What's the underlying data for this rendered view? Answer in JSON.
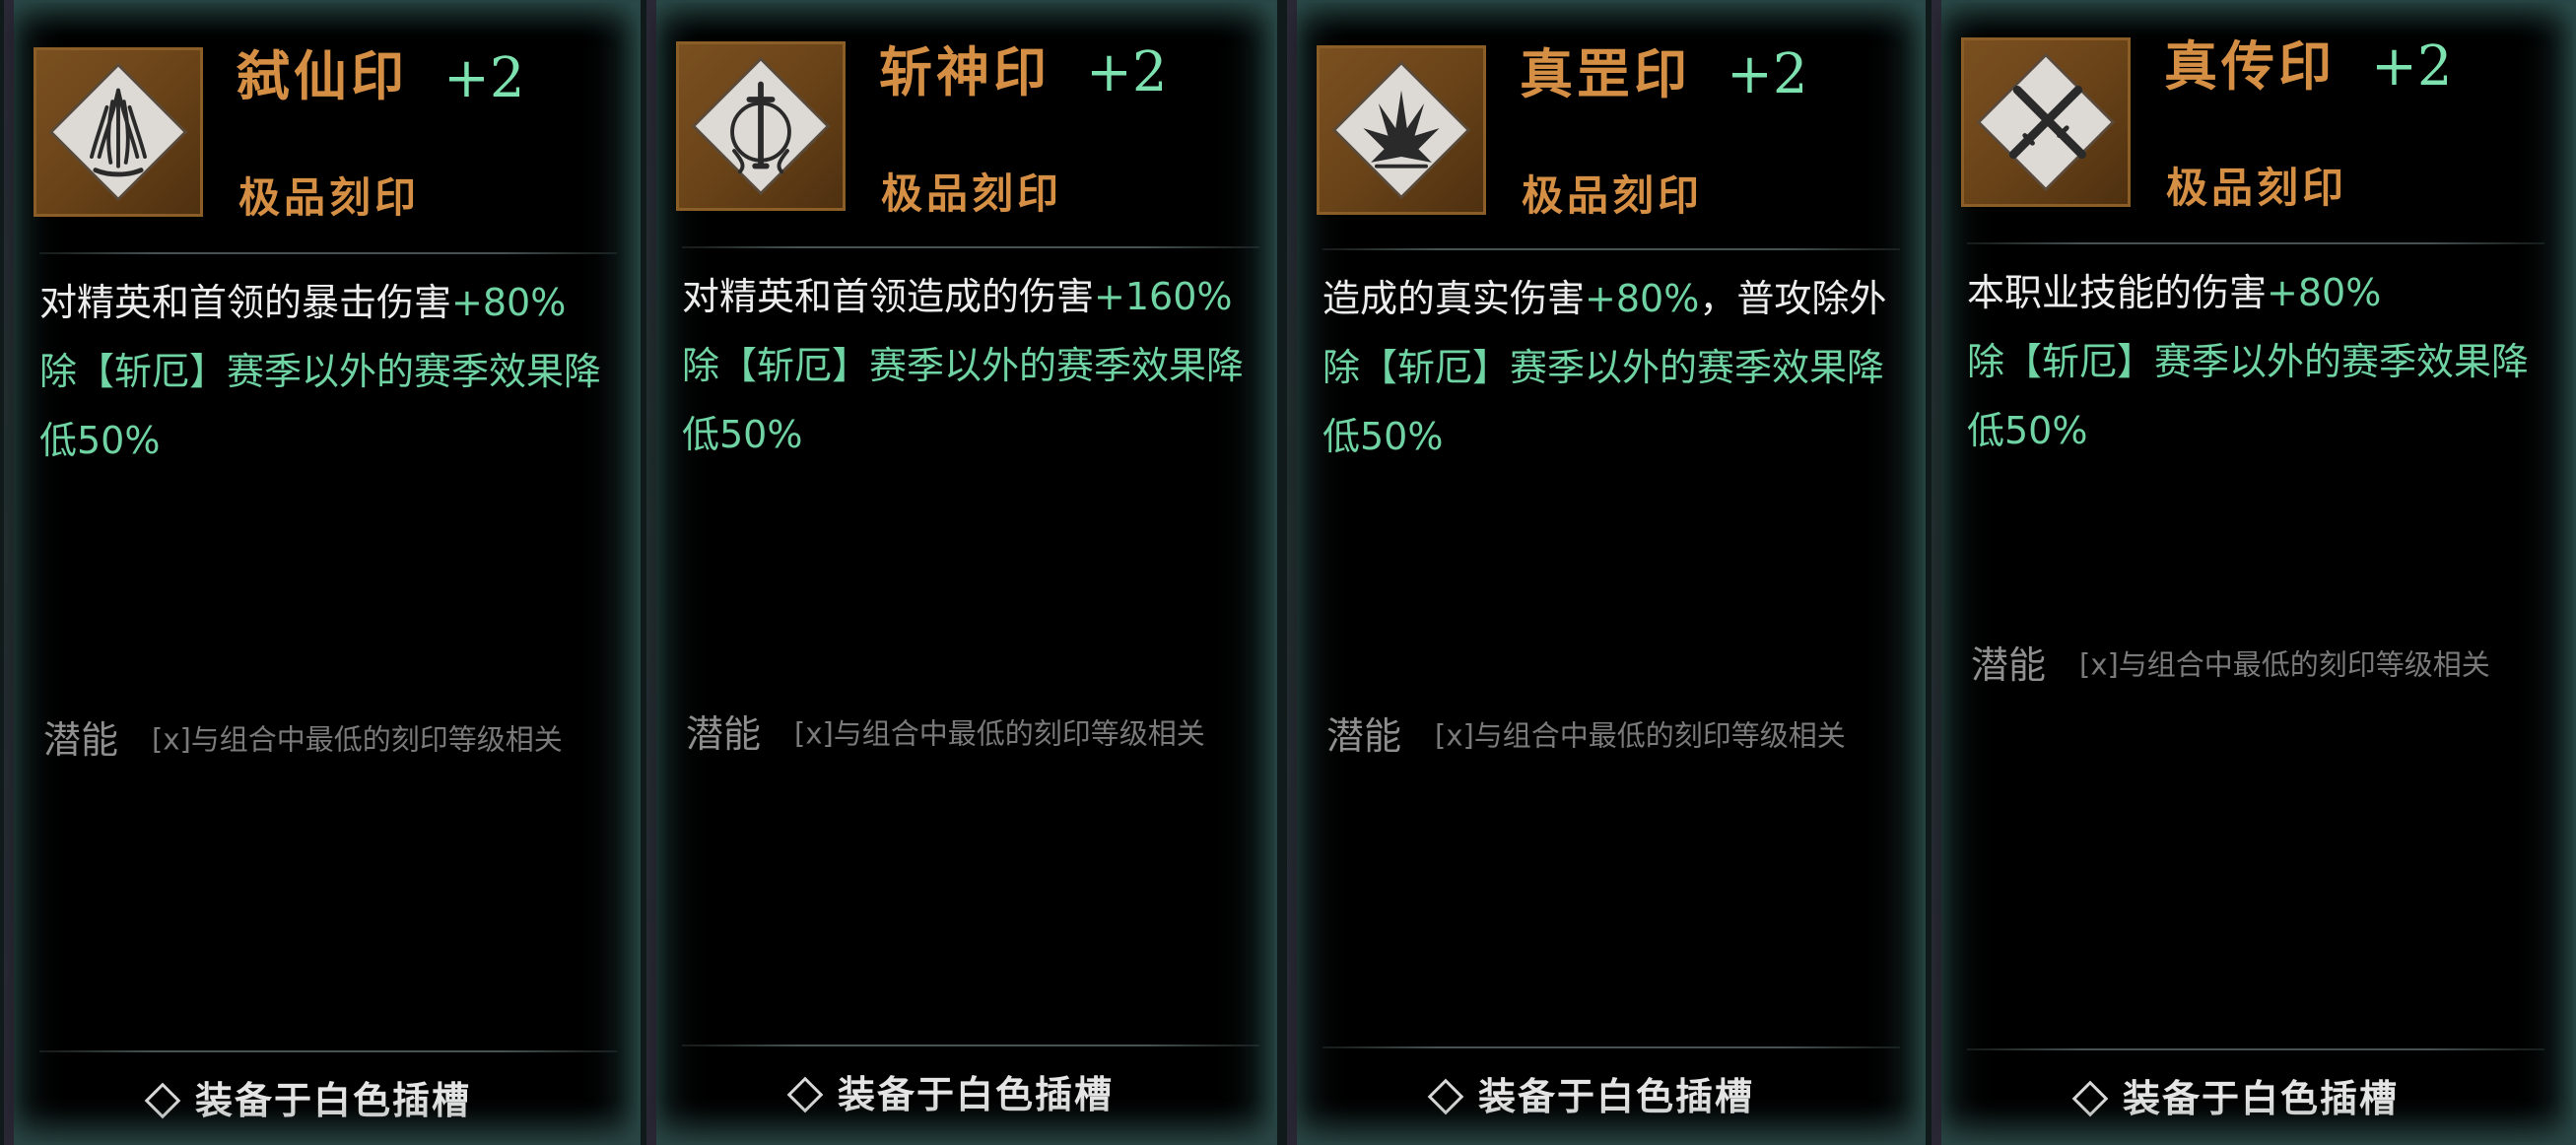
{
  "cards": [
    {
      "title": "弑仙印",
      "level": "+2",
      "grade": "极品刻印",
      "icon": "leaf-flame-seal-icon",
      "desc": [
        {
          "text": "对精英和首领的暴击伤害",
          "color": "white"
        },
        {
          "text": "+80%",
          "color": "green"
        },
        {
          "text": "除【斩厄】赛季以外的赛季效果降低50%",
          "color": "green"
        }
      ],
      "potential_label": "潜能",
      "potential_note": "[x]与组合中最低的刻印等级相关",
      "footer": "装备于白色插槽"
    },
    {
      "title": "斩神印",
      "level": "+2",
      "grade": "极品刻印",
      "icon": "sword-ring-seal-icon",
      "desc": [
        {
          "text": "对精英和首领造成的伤害",
          "color": "white"
        },
        {
          "text": "+160%",
          "color": "green"
        },
        {
          "text": "除【斩厄】赛季以外的赛季效果降低50%",
          "color": "green"
        }
      ],
      "potential_label": "潜能",
      "potential_note": "[x]与组合中最低的刻印等级相关",
      "footer": "装备于白色插槽"
    },
    {
      "title": "真罡印",
      "level": "+2",
      "grade": "极品刻印",
      "icon": "spike-burst-seal-icon",
      "desc": [
        {
          "text": "造成的真实伤害",
          "color": "white"
        },
        {
          "text": "+80%",
          "color": "green"
        },
        {
          "text": "，普攻除外",
          "color": "white"
        },
        {
          "text": "除【斩厄】赛季以外的赛季效果降低50%",
          "color": "green"
        }
      ],
      "potential_label": "潜能",
      "potential_note": "[x]与组合中最低的刻印等级相关",
      "footer": "装备于白色插槽"
    },
    {
      "title": "真传印",
      "level": "+2",
      "grade": "极品刻印",
      "icon": "crossed-swords-seal-icon",
      "desc": [
        {
          "text": "本职业技能的伤害",
          "color": "white"
        },
        {
          "text": "+80%",
          "color": "green"
        },
        {
          "text": "除【斩厄】赛季以外的赛季效果降低50%",
          "color": "green"
        }
      ],
      "potential_label": "潜能",
      "potential_note": "[x]与组合中最低的刻印等级相关",
      "footer": "装备于白色插槽"
    }
  ],
  "colors": {
    "title_orange": "#d58f45",
    "value_green": "#6fd3a3",
    "plus_green": "#7de2b0",
    "text_white": "#ededed",
    "muted_grey": "#8f8f8f",
    "icon_frame_brown": "#6a4318"
  }
}
